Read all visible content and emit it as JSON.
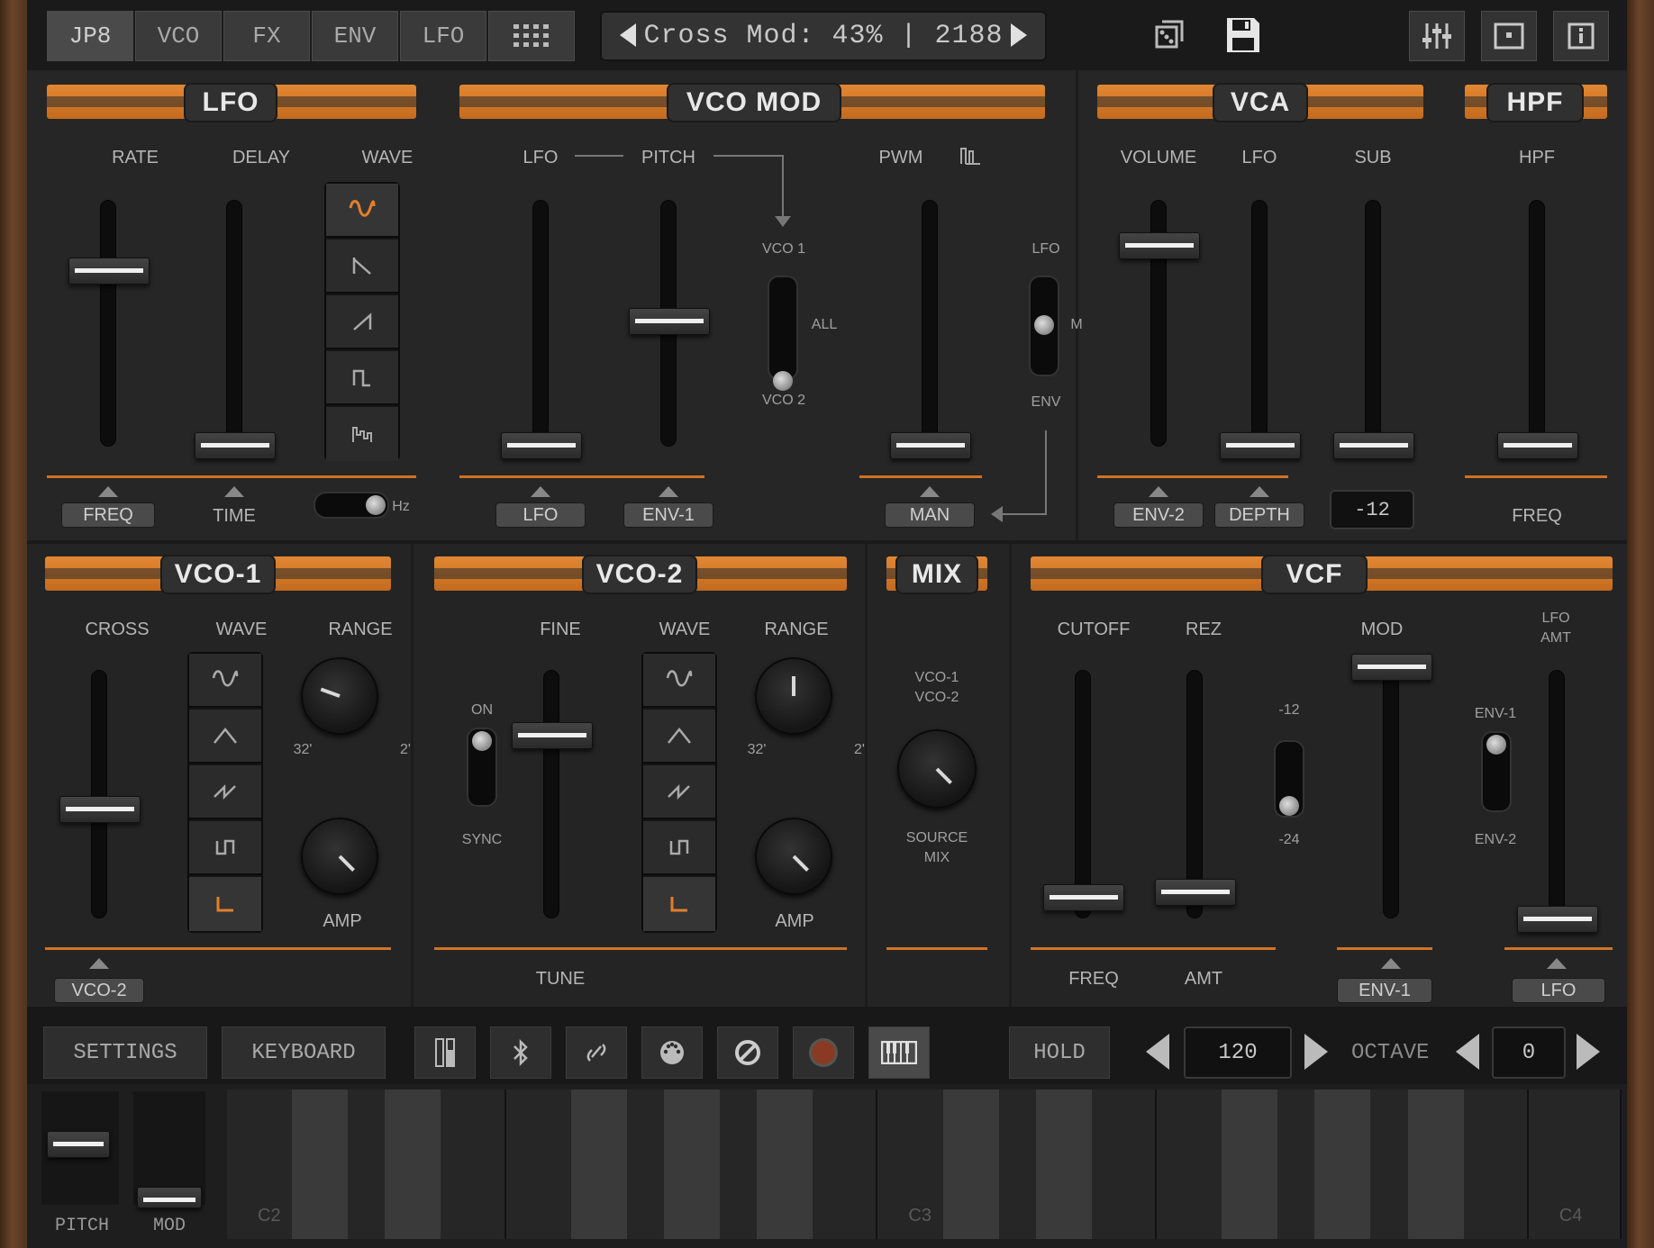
{
  "top_tabs": [
    "JP8",
    "VCO",
    "FX",
    "ENV",
    "LFO"
  ],
  "display": {
    "text": "Cross Mod: 43% | 2188"
  },
  "icons": {
    "grid": "grid-icon",
    "dice": "dice-icon",
    "save": "save-icon",
    "mixer": "mixer-icon",
    "window": "window-icon",
    "info": "info-icon"
  },
  "colors": {
    "accent": "#d57a2b",
    "panel": "#262626"
  },
  "lfo": {
    "title": "LFO",
    "labels": {
      "rate": "RATE",
      "delay": "DELAY",
      "wave": "WAVE",
      "freq": "FREQ",
      "time": "TIME",
      "hz": "Hz"
    },
    "rate_value": 0.72,
    "delay_value": 0.0
  },
  "vco_mod": {
    "title": "VCO MOD",
    "labels": {
      "lfo": "LFO",
      "pitch": "PITCH",
      "pwm": "PWM",
      "vco1": "VCO 1",
      "all": "ALL",
      "vco2": "VCO 2",
      "sw_lfo": "LFO",
      "sw_m": "M",
      "sw_env": "ENV"
    },
    "tags": {
      "lfo": "LFO",
      "env1": "ENV-1",
      "man": "MAN"
    }
  },
  "vca": {
    "title": "VCA",
    "labels": {
      "volume": "VOLUME",
      "lfo": "LFO",
      "sub": "SUB"
    },
    "tags": {
      "env2": "ENV-2",
      "depth": "DEPTH"
    },
    "sub_value": "-12"
  },
  "hpf": {
    "title": "HPF",
    "labels": {
      "hpf": "HPF",
      "freq": "FREQ"
    }
  },
  "vco1": {
    "title": "VCO-1",
    "labels": {
      "cross": "CROSS",
      "wave": "WAVE",
      "range": "RANGE",
      "r32": "32'",
      "r2": "2'",
      "amp": "AMP"
    },
    "tags": {
      "vco2": "VCO-2"
    }
  },
  "vco2": {
    "title": "VCO-2",
    "labels": {
      "fine": "FINE",
      "wave": "WAVE",
      "range": "RANGE",
      "on": "ON",
      "sync": "SYNC",
      "r32": "32'",
      "r2": "2'",
      "amp": "AMP",
      "tune": "TUNE"
    }
  },
  "mix": {
    "title": "MIX",
    "labels": {
      "vco1": "VCO-1",
      "vco2": "VCO-2",
      "source": "SOURCE",
      "mix": "MIX"
    }
  },
  "vcf": {
    "title": "VCF",
    "labels": {
      "cutoff": "CUTOFF",
      "rez": "REZ",
      "mod": "MOD",
      "lfo": "LFO",
      "amt": "AMT",
      "m12": "-12",
      "m24": "-24",
      "env1": "ENV-1",
      "env2": "ENV-2",
      "freq": "FREQ",
      "amt2": "AMT"
    },
    "tags": {
      "env1": "ENV-1",
      "lfo": "LFO"
    }
  },
  "bottom": {
    "settings": "SETTINGS",
    "keyboard": "KEYBOARD",
    "hold": "HOLD",
    "tempo": "120",
    "octave_label": "OCTAVE",
    "octave": "0",
    "pitch": "PITCH",
    "mod": "MOD"
  },
  "keys": {
    "c2": "C2",
    "c3": "C3",
    "c4": "C4"
  }
}
